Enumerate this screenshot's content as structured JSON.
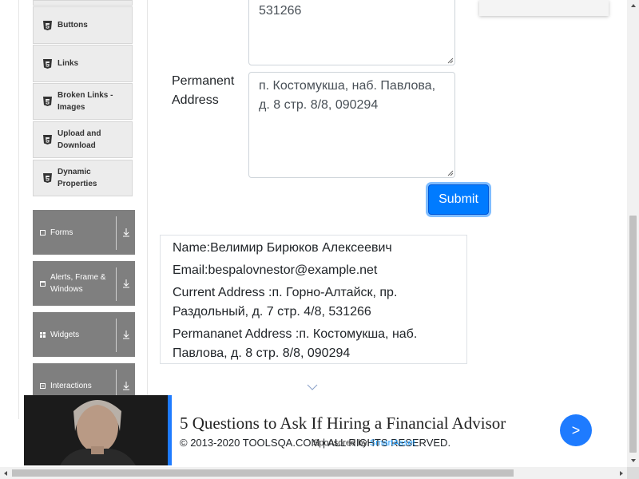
{
  "sidebar": {
    "sub_items": [
      {
        "label": "Buttons"
      },
      {
        "label": "Links"
      },
      {
        "label": "Broken Links - Images"
      },
      {
        "label": "Upload and Download"
      },
      {
        "label": "Dynamic Properties"
      }
    ],
    "groups": [
      {
        "label": "Forms",
        "icon": "form-icon"
      },
      {
        "label": "Alerts, Frame & Windows",
        "icon": "window-icon"
      },
      {
        "label": "Widgets",
        "icon": "widgets-icon"
      },
      {
        "label": "Interactions",
        "icon": "interactions-icon"
      }
    ]
  },
  "form": {
    "current_address_tail": "531266",
    "permanent_address_label": "Permanent Address",
    "permanent_address_value": "п. Костомукша, наб. Павлова, д. 8 стр. 8/8, 090294",
    "submit_label": "Submit"
  },
  "output": {
    "name": "Name:Велимир Бирюков Алексеевич",
    "email": "Email:bespalovnestor@example.net",
    "current_address": "Current Address :п. Горно-Алтайск, пр. Раздольный, д. 7 стр. 4/8, 531266",
    "permanent_address": "Permananet Address :п. Костомукша, наб. Павлова, д. 8 стр. 8/8, 090294"
  },
  "footer": {
    "copyright": "© 2013-2020 TOOLSQA.COM | ALL RIGHTS RESERVED.",
    "sponsored_prefix": "Sponsored by",
    "sponsored_brand": "SmartAsset"
  },
  "ad": {
    "title": "5 Questions to Ask If Hiring a Financial Advisor",
    "next_label": ">"
  },
  "colors": {
    "submit": "#007bff",
    "sidebar_group": "#7f7f7f",
    "ad_accent": "#1e7bff"
  }
}
